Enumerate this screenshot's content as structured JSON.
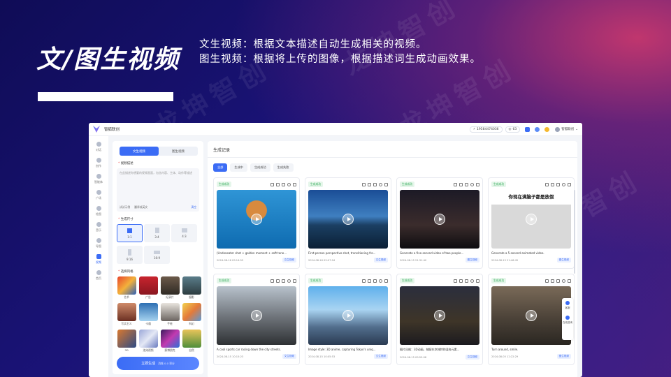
{
  "slide": {
    "title": "文/图生视频",
    "desc_line1": "文生视频：根据文本描述自动生成相关的视频。",
    "desc_line2": "图生视频：根据将上传的图像，根据描述词生成动画效果。",
    "watermark": "龙坤智创"
  },
  "app": {
    "brand": "智狐联创",
    "phone": "19584474036",
    "points": "63",
    "username": "智狐联创",
    "sidebar": [
      {
        "label": "对话",
        "active": false
      },
      {
        "label": "创作",
        "active": false
      },
      {
        "label": "智能体",
        "active": false
      },
      {
        "label": "广场",
        "active": false
      },
      {
        "label": "绘图",
        "active": false
      },
      {
        "label": "音乐",
        "active": false
      },
      {
        "label": "导图",
        "active": false
      },
      {
        "label": "视频",
        "active": true
      },
      {
        "label": "首页",
        "active": false
      }
    ],
    "panel": {
      "tab_text": "文生视频",
      "tab_image": "图生视频",
      "desc_label": "视频描述",
      "placeholder": "在此描述你想要的视频画面，包含内容、主体、动作等描述",
      "example": "试试示例",
      "translate": "翻译成英文",
      "clear": "清空",
      "size_label": "生成尺寸",
      "sizes": [
        "1:1",
        "3:4",
        "4:3",
        "9:16",
        "16:9"
      ],
      "style_label": "选择风格",
      "styles": [
        "艺术",
        "广告",
        "纪录片",
        "摄影",
        "写实主义",
        "卡通",
        "手绘",
        "科幻",
        "3D",
        "渲染视频",
        "赛博朋克",
        "自然"
      ],
      "generate": "立即生成",
      "cost": "消耗 0.0 积分"
    },
    "main": {
      "header": "生成记录",
      "filters": [
        "全部",
        "生成中",
        "生成成功",
        "生成失败"
      ],
      "cards": [
        {
          "status": "生成成功",
          "caption": "(Underwater shot + golden moment + soft tone...",
          "time": "2024-08-16 09:14:55",
          "type": "文生视频",
          "theme": "corgi"
        },
        {
          "status": "生成成功",
          "caption": "First-person perspective shot, transitioning fro...",
          "time": "2024-08-16 09:07:04",
          "type": "文生视频",
          "theme": "coast"
        },
        {
          "status": "生成成功",
          "caption": "Generate a five-second video of two people...",
          "time": "2024-08-15 21:31:40",
          "type": "图生视频",
          "theme": "poster"
        },
        {
          "status": "生成成功",
          "caption": "Generate a 5-second animated video.",
          "time": "2024-08-15 21:46:45",
          "type": "图生视频",
          "theme": "meme"
        },
        {
          "status": "生成成功",
          "caption": "A cool sports car racing down the city streets.",
          "time": "2024-08-15 10:15:23",
          "type": "文生视频",
          "theme": "car"
        },
        {
          "status": "生成成功",
          "caption": "Image style: 3D anime, capturing Tokyo's uniq...",
          "time": "2024-08-15 10:05:53",
          "type": "文生视频",
          "theme": "tokyo"
        },
        {
          "status": "生成成功",
          "caption": "图片风格：3D动画，捕捉东京独特的混合元素...",
          "time": "2024-08-15 09:55:08",
          "type": "文生视频",
          "theme": "anime"
        },
        {
          "status": "生成成功",
          "caption": "Turn around, smile.",
          "time": "2024-08-05 12:22:29",
          "type": "图生视频",
          "theme": "portrait"
        }
      ],
      "meme_text": "你现在满脑子都是放假"
    },
    "float": [
      "客服",
      "在线咨询"
    ]
  }
}
